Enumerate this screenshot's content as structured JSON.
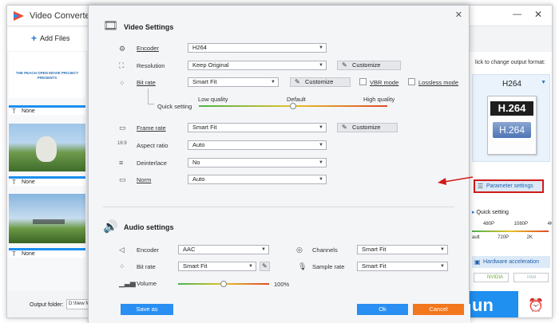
{
  "app": {
    "title": "Video Converter",
    "minimize": "—",
    "close": "✕"
  },
  "toolbar": {
    "add_files": "Add Files"
  },
  "left_list": {
    "thumb1_text": "THE PEACH OPEN MOVIE PROJECT PRESENTS",
    "subtitles": [
      "None",
      "None",
      "None"
    ]
  },
  "right_panel": {
    "hint": "lick to change output format:",
    "format_name": "H264",
    "icon_top": "H.264",
    "icon_bottom": "H.264",
    "param_settings": "Parameter settings",
    "quick_setting": "Quick setting",
    "quick_top": [
      "480P",
      "1080P",
      "4K"
    ],
    "quick_bottom": [
      "ault",
      "720P",
      "2K"
    ],
    "hw_accel": "Hardware acceleration",
    "nvidia": "NVIDIA",
    "intel": "Intel",
    "run": "un"
  },
  "bottom": {
    "output_label": "Output folder:",
    "output_path": "D:\\New fo"
  },
  "dialog": {
    "close": "✕",
    "video_title": "Video Settings",
    "audio_title": "Audio settings",
    "video": {
      "encoder_label": "Encoder",
      "encoder": "H264",
      "resolution_label": "Resolution",
      "resolution": "Keep Original",
      "customize": "Customize",
      "bitrate_label": "Bit rate",
      "bitrate": "Smart Fit",
      "vbr": "VBR mode",
      "lossless": "Lossless mode",
      "quick_setting_label": "Quick setting",
      "low_quality": "Low quality",
      "default": "Default",
      "high_quality": "High quality",
      "quality_level": 0.5,
      "framerate_label": "Frame rate",
      "framerate": "Smart Fit",
      "aspect_label": "Aspect ratio",
      "aspect": "Auto",
      "deinterlace_label": "Deinterlace",
      "deinterlace": "No",
      "norm_label": "Norm",
      "norm": "Auto"
    },
    "audio": {
      "encoder_label": "Encoder",
      "encoder": "AAC",
      "channels_label": "Channels",
      "channels": "Smart Fit",
      "bitrate_label": "Bit rate",
      "bitrate": "Smart Fit",
      "samplerate_label": "Sample rate",
      "samplerate": "Smart Fit",
      "volume_label": "Volume",
      "volume_value": "100%",
      "volume_level": 0.5
    },
    "save_as": "Save as",
    "ok": "Ok",
    "cancel": "Cancel"
  },
  "colors": {
    "accent": "#1f8ff0",
    "cancel": "#f3771c",
    "highlight": "#d11a1a"
  }
}
